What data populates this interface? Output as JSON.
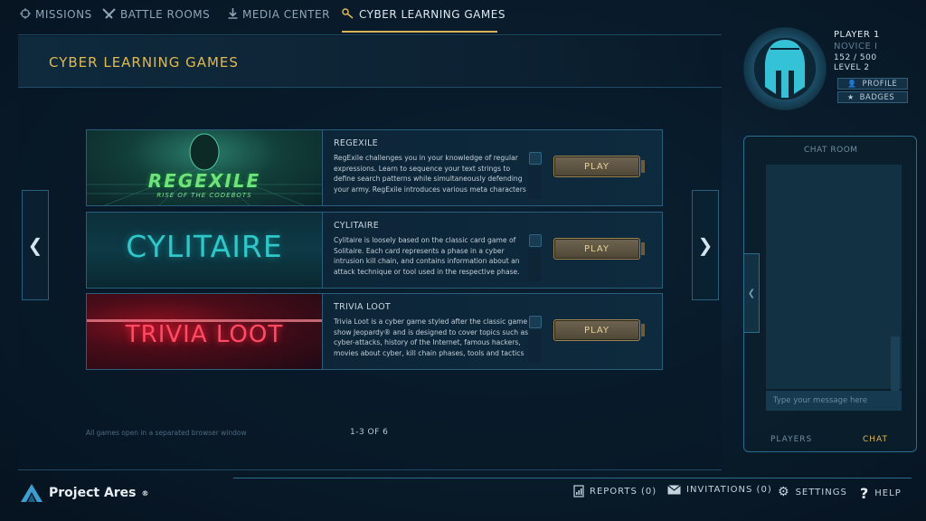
{
  "nav": {
    "tabs": [
      {
        "label": "MISSIONS",
        "icon": "crosshair-icon"
      },
      {
        "label": "BATTLE ROOMS",
        "icon": "swords-icon"
      },
      {
        "label": "MEDIA CENTER",
        "icon": "download-icon"
      },
      {
        "label": "CYBER LEARNING GAMES",
        "icon": "key-icon",
        "active": true
      }
    ]
  },
  "page": {
    "title": "CYBER LEARNING GAMES",
    "footnote": "All games open in a separated browser window",
    "pagination": "1-3 OF 6"
  },
  "games": [
    {
      "name": "REGEXILE",
      "thumb_title": "REGEXILE",
      "thumb_subtitle": "RISE OF THE CODEBOTS",
      "description": "RegExile challenges you in your knowledge of regular expressions.  Learn to sequence your text strings to define search patterns while simultaneously defending your army.  RegExile introduces various meta characters",
      "play_label": "PLAY"
    },
    {
      "name": "CYLITAIRE",
      "thumb_title": "CYLITAIRE",
      "description": "Cylitaire is loosely based on the classic card game of Solitaire. Each card represents a phase in a cyber intrusion kill chain, and contains information about an attack technique or tool used in the respective phase.",
      "play_label": "PLAY"
    },
    {
      "name": "TRIVIA LOOT",
      "thumb_title": "TRIVIA LOOT",
      "description": "Trivia Loot is a cyber game styled after the classic game show Jeopardy® and is designed to cover topics such as cyber-attacks, history of the Internet, famous hackers, movies about cyber, kill chain phases, tools and tactics",
      "play_label": "PLAY"
    }
  ],
  "player": {
    "name": "PLAYER 1",
    "rank": "NOVICE I",
    "xp": "152 / 500",
    "level": "LEVEL 2",
    "profile_label": "PROFILE",
    "badges_label": "BADGES"
  },
  "chat": {
    "title": "CHAT ROOM",
    "placeholder": "Type your message here",
    "players_tab": "PLAYERS",
    "chat_tab": "CHAT"
  },
  "footer": {
    "brand": "Project Ares",
    "trademark": "®",
    "reports": "REPORTS (0)",
    "invitations": "INVITATIONS (0)",
    "settings": "SETTINGS",
    "help": "HELP"
  },
  "colors": {
    "accent_gold": "#e1b94f",
    "panel_border": "#2a5f7c",
    "helmet_teal": "#34c3d6",
    "trivia_red": "#ff4b63"
  }
}
